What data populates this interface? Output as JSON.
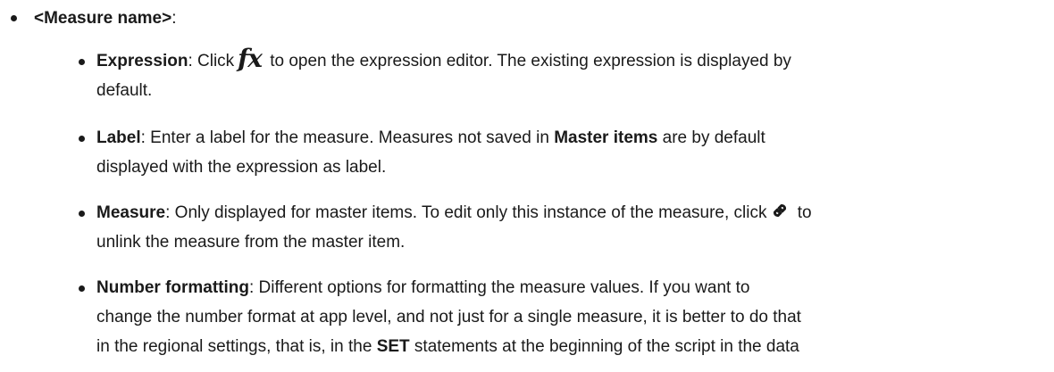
{
  "list": {
    "measure_name": "<Measure name>",
    "measure_name_suffix": ":",
    "items": [
      {
        "term": "Expression",
        "lines": [
          {
            "before": ": Click",
            "after": " to open the expression editor. The existing expression is displayed by"
          },
          {
            "text": "default."
          }
        ]
      },
      {
        "term": "Label",
        "lines": [
          {
            "before": ": Enter a label for the measure. Measures not saved in ",
            "bold": "Master items",
            "after": " are by default"
          },
          {
            "text": "displayed with the expression as label."
          }
        ]
      },
      {
        "term": "Measure",
        "lines": [
          {
            "before": ": Only displayed for master items. To edit only this instance of the measure, click",
            "after": " to"
          },
          {
            "text": "unlink the measure from the master item."
          }
        ]
      },
      {
        "term": "Number formatting",
        "lines": [
          {
            "text": ": Different options for formatting the measure values. If you want to"
          },
          {
            "text": "change the number format at app level, and not just for a single measure, it is better to do that"
          },
          {
            "before": "in the regional settings, that is, in the ",
            "bold": "SET",
            "after": " statements at the beginning of the script in the data"
          }
        ]
      }
    ]
  },
  "icons": {
    "fx": "fx-icon",
    "fx_glyph": "fx",
    "link": "link-icon"
  }
}
